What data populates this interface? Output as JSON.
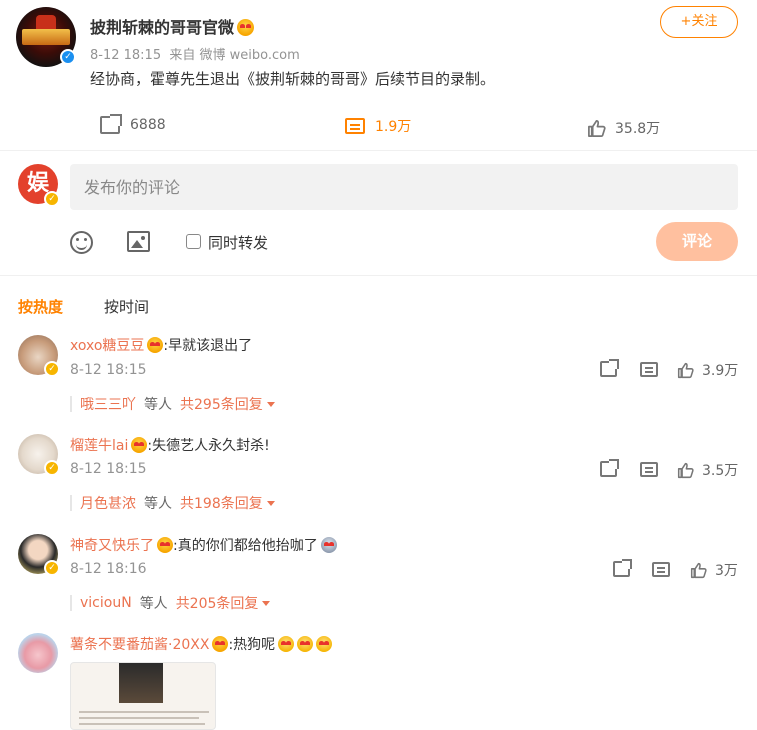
{
  "post": {
    "author": "披荆斩棘的哥哥官微",
    "time": "8-12 18:15",
    "source": "来自 微博 weibo.com",
    "text": "经协商，霍尊先生退出《披荆斩棘的哥哥》后续节目的录制。",
    "follow_label": "+关注",
    "share_count": "6888",
    "comment_count": "1.9万",
    "like_count": "35.8万",
    "verified": "verified-badge-blue"
  },
  "composer": {
    "placeholder": "发布你的评论",
    "also_repost_label": "同时转发",
    "submit_label": "评论",
    "avatar_char": "娱"
  },
  "tabs": [
    {
      "label": "按热度",
      "active": true
    },
    {
      "label": "按时间",
      "active": false
    }
  ],
  "comments": [
    {
      "user": "xoxo糖豆豆",
      "text": ":早就该退出了",
      "time": "8-12 18:15",
      "reply_user": "哦三三吖",
      "reply_mid": "等人",
      "reply_count": "共295条回复",
      "likes": "3.9万"
    },
    {
      "user": "榴莲牛lai",
      "text": ":失德艺人永久封杀!",
      "time": "8-12 18:15",
      "reply_user": "月色甚浓",
      "reply_mid": "等人",
      "reply_count": "共198条回复",
      "likes": "3.5万"
    },
    {
      "user": "神奇又快乐了",
      "text": ":真的你们都给他抬咖了",
      "time": "8-12 18:16",
      "reply_user": "viciouN",
      "reply_mid": "等人",
      "reply_count": "共205条回复",
      "likes": "3万"
    },
    {
      "user": "薯条不要番茄酱·20XX",
      "text": ":热狗呢"
    }
  ],
  "colors": {
    "accent": "#ff8200",
    "name": "#eb7350",
    "submit_bg": "#ffc09f"
  }
}
